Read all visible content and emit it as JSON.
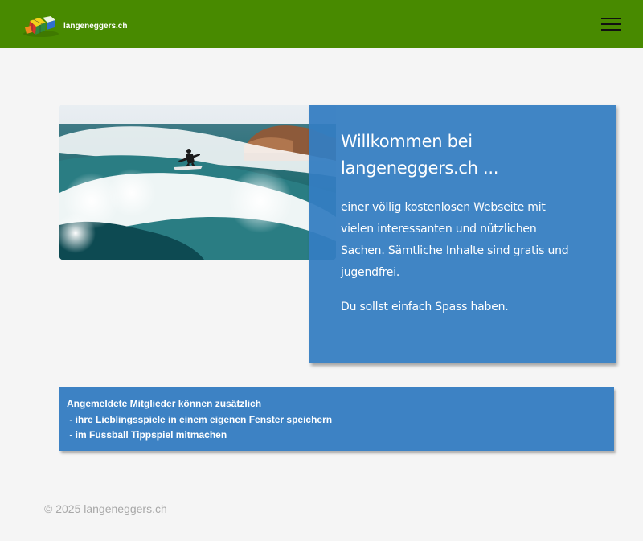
{
  "header": {
    "site_name": "langeneggers.ch",
    "logo_icon": "rubiks-cube-logo-icon",
    "menu_icon": "hamburger-menu-icon",
    "background_color": "#488a00"
  },
  "hero": {
    "image_icon": "surfer-wave-photo"
  },
  "welcome": {
    "title_line1": "Willkommen bei",
    "title_line2": "langeneggers.ch ...",
    "body_line1": "einer völlig kostenlosen Webseite mit",
    "body_line2": "vielen interessanten und nützlichen",
    "body_line3": "Sachen. Sämtliche Inhalte sind gratis und",
    "body_line4": "jugendfrei.",
    "fun_text": "Du sollst einfach Spass haben.",
    "card_color": "#347dc1"
  },
  "members": {
    "line1": "Angemeldete Mitglieder können zusätzlich",
    "line2": " - ihre Lieblingsspiele in einem eigenen Fenster speichern",
    "line3": " - im Fussball Tippspiel mitmachen",
    "box_color": "#3d82c4"
  },
  "footer": {
    "copyright": "© 2025 langeneggers.ch"
  }
}
